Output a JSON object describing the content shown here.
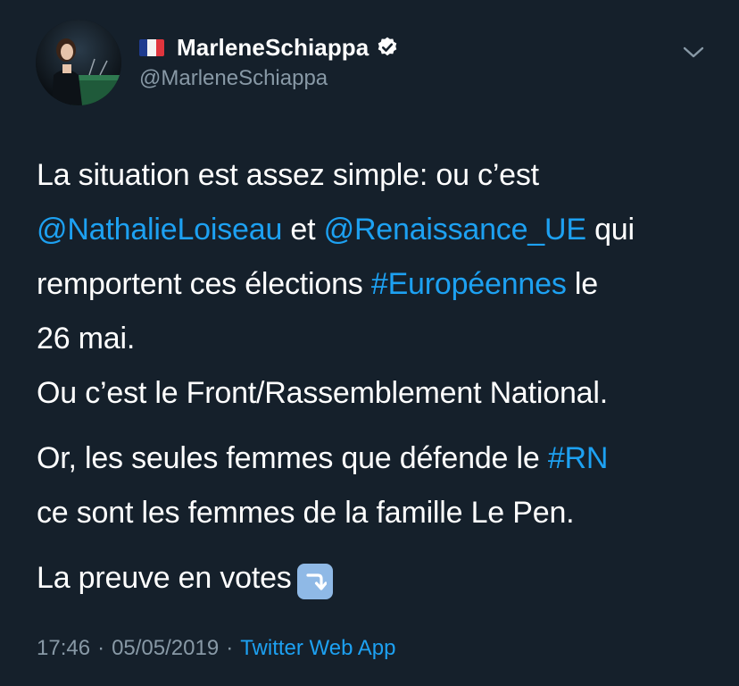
{
  "tweet": {
    "author": {
      "display_name": "MarleneSchiappa",
      "handle": "@MarleneSchiappa",
      "flag_icon": "french-flag-icon",
      "verified_icon": "verified-badge-icon"
    },
    "text": {
      "line1_part1": "La situation est assez simple: ou c’est",
      "mention1": "@NathalieLoiseau",
      "conj": " et ",
      "mention2": "@Renaissance_UE",
      "line2_end": " qui",
      "line3_start": "remportent ces élections ",
      "hashtag1": "#Européennes",
      "line3_end": " le",
      "line4": "26 mai.",
      "line5": "Ou c’est le Front/Rassemblement National.",
      "para2_start": "Or, les seules femmes que défende le ",
      "hashtag2": "#RN",
      "para2_line2": "ce sont les femmes de la famille Le Pen.",
      "para3": "La preuve en votes",
      "emoji": "⤵️"
    },
    "meta": {
      "time": "17:46",
      "date": "05/05/2019",
      "separator": "·",
      "source": "Twitter Web App"
    }
  },
  "colors": {
    "background": "#15202b",
    "text": "#ffffff",
    "secondary": "#8899a6",
    "link": "#1da1f2"
  }
}
